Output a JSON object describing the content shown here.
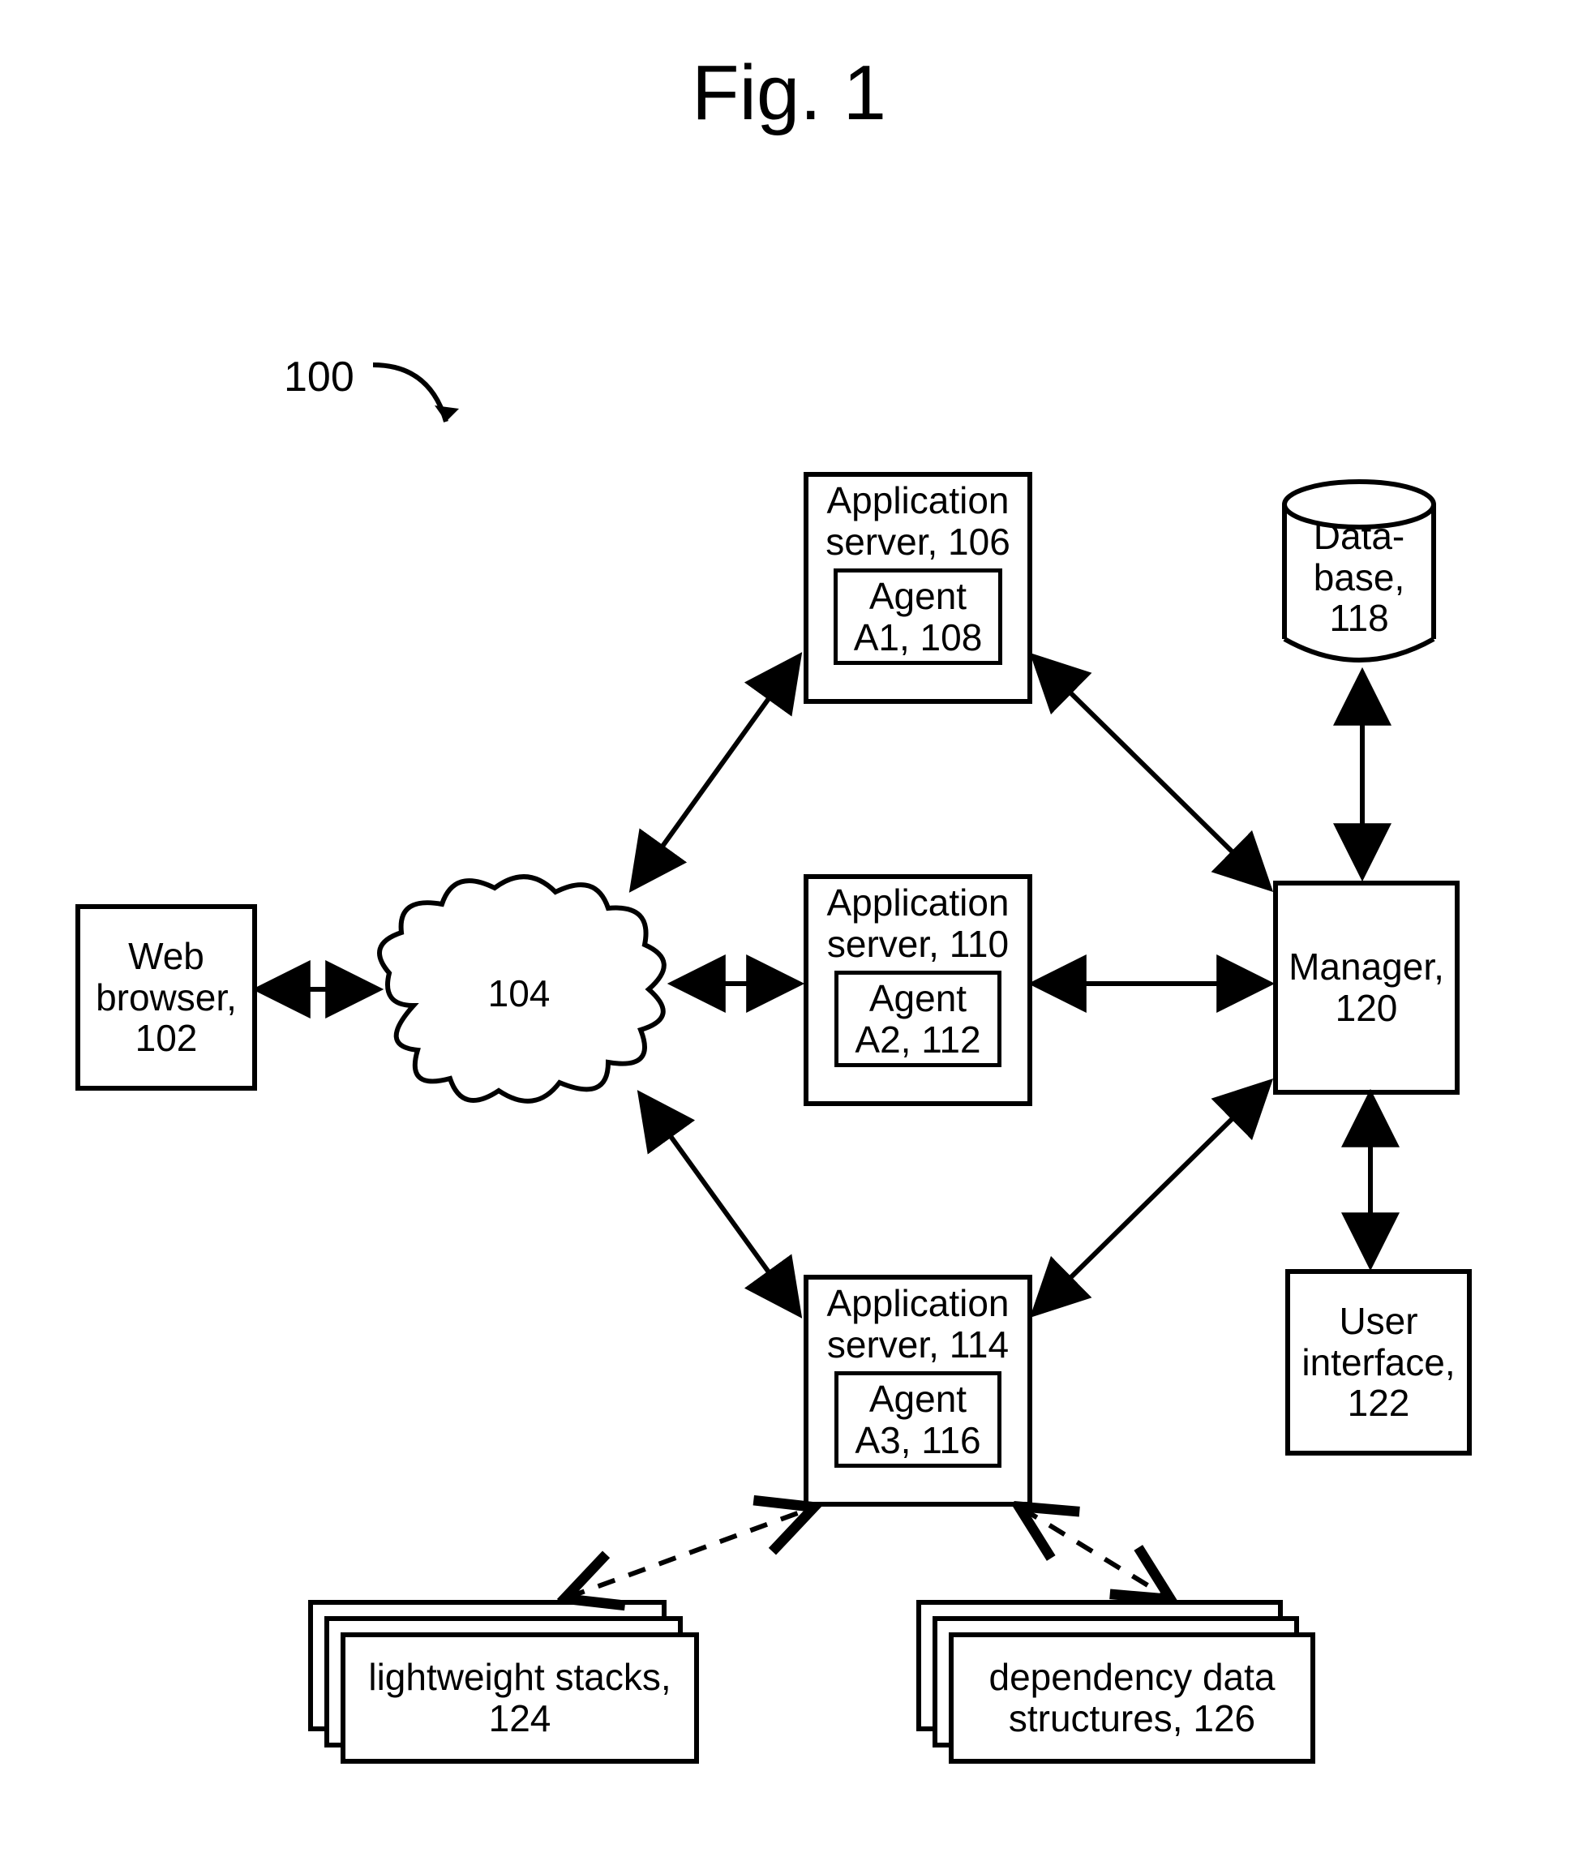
{
  "figure": {
    "title": "Fig. 1",
    "ref_label": "100"
  },
  "nodes": {
    "web_browser": {
      "line1": "Web",
      "line2": "browser,",
      "line3": "102"
    },
    "cloud": {
      "label": "104"
    },
    "app_server1": {
      "line1": "Application",
      "line2": "server, 106",
      "agent_line1": "Agent",
      "agent_line2": "A1, 108"
    },
    "app_server2": {
      "line1": "Application",
      "line2": "server, 110",
      "agent_line1": "Agent",
      "agent_line2": "A2, 112"
    },
    "app_server3": {
      "line1": "Application",
      "line2": "server, 114",
      "agent_line1": "Agent",
      "agent_line2": "A3, 116"
    },
    "database": {
      "line1": "Data-",
      "line2": "base,",
      "line3": "118"
    },
    "manager": {
      "line1": "Manager,",
      "line2": "120"
    },
    "user_interface": {
      "line1": "User",
      "line2": "interface,",
      "line3": "122"
    },
    "lw_stacks": {
      "line1": "lightweight stacks,",
      "line2": "124"
    },
    "dep_structs": {
      "line1": "dependency data",
      "line2": "structures, 126"
    }
  }
}
